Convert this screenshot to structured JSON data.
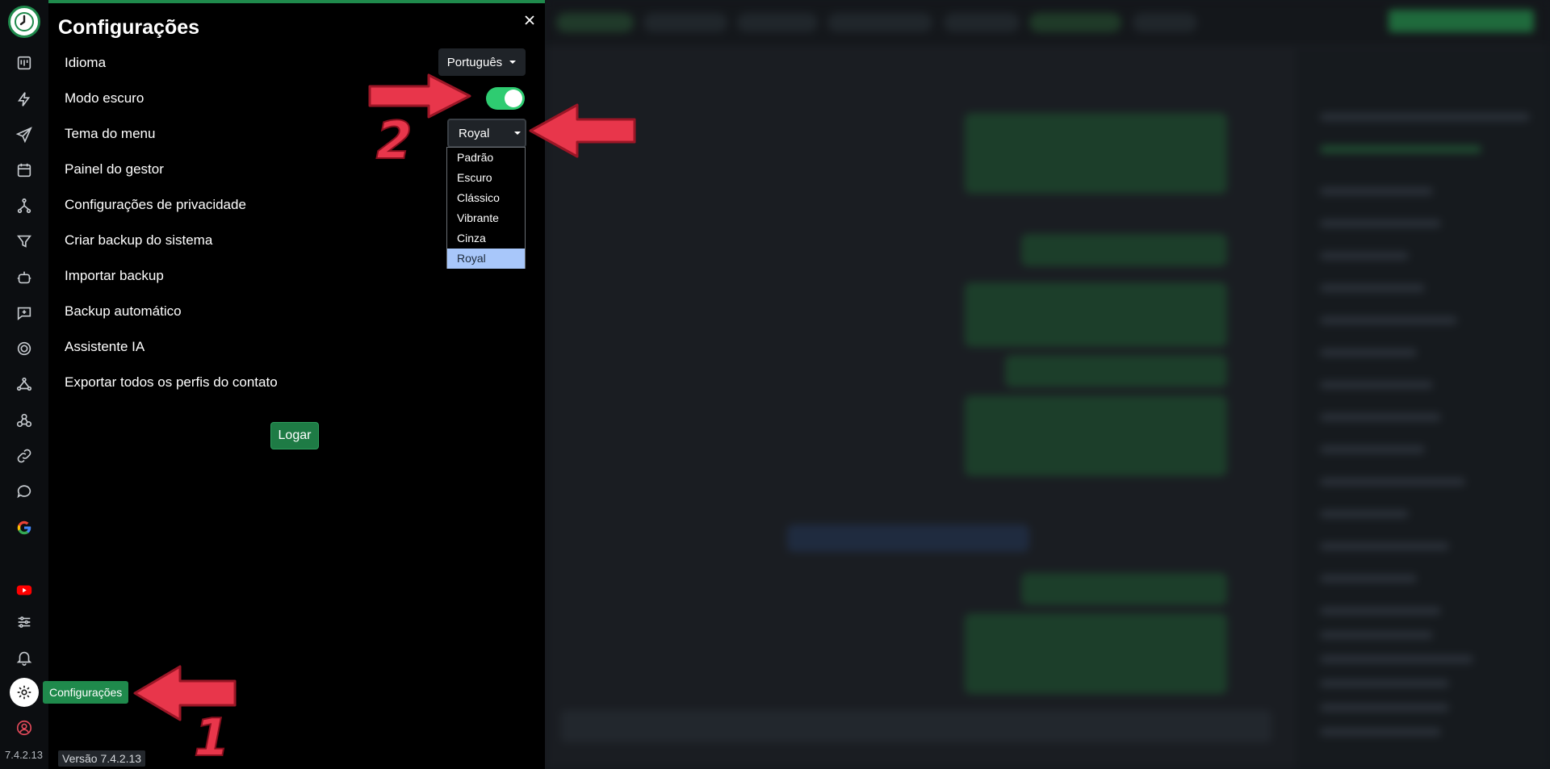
{
  "rail": {
    "version_label": "7.4.2.13",
    "icons": [
      "clock-logo-icon",
      "kanban-icon",
      "lightning-icon",
      "send-icon",
      "calendar-icon",
      "flow-icon",
      "filter-icon",
      "bot-icon",
      "chat-plus-icon",
      "target-icon",
      "network-icon",
      "webhook-icon",
      "link-icon",
      "chat-bubble-icon",
      "google-icon",
      "youtube-icon",
      "sliders-icon",
      "bell-icon",
      "gear-icon",
      "user-circle-icon"
    ]
  },
  "tooltip": {
    "label": "Configurações"
  },
  "settings": {
    "title": "Configurações",
    "items": [
      "Idioma",
      "Modo escuro",
      "Tema do menu",
      "Painel do gestor",
      "Configurações de privacidade",
      "Criar backup do sistema",
      "Importar backup",
      "Backup automático",
      "Assistente IA",
      "Exportar todos os perfis do contato"
    ],
    "language": {
      "selected": "Português"
    },
    "dark_mode": {
      "on": true
    },
    "theme": {
      "selected": "Royal",
      "options": [
        "Padrão",
        "Escuro",
        "Clássico",
        "Vibrante",
        "Cinza",
        "Royal"
      ]
    },
    "login_label": "Logar",
    "version_label": "Versão 7.4.2.13"
  },
  "annotations": {
    "step1": "1",
    "step2": "2",
    "color": "#e8364b"
  },
  "colors": {
    "accent": "#1f8a4c",
    "toggle_on": "#2ecc71",
    "selected_option": "#a8c7fa"
  }
}
